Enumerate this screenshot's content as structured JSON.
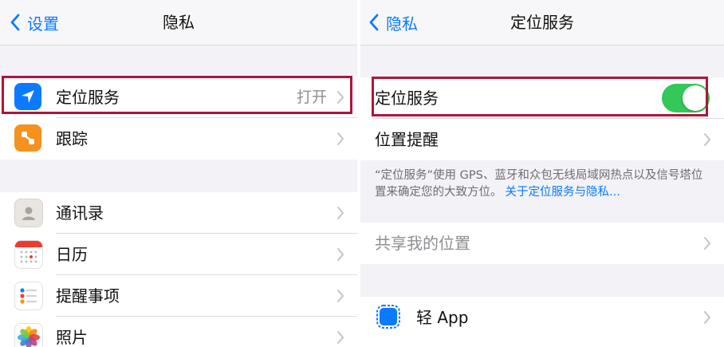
{
  "left": {
    "back_label": "设置",
    "title": "隐私",
    "group1": [
      {
        "label": "定位服务",
        "value": "打开",
        "icon": "location-arrow-icon",
        "color": "#0a7aff"
      },
      {
        "label": "跟踪",
        "icon": "tracking-icon",
        "color": "#f5911e"
      }
    ],
    "group2": [
      {
        "label": "通讯录",
        "icon": "contacts-icon"
      },
      {
        "label": "日历",
        "icon": "calendar-icon"
      },
      {
        "label": "提醒事项",
        "icon": "reminders-icon"
      },
      {
        "label": "照片",
        "icon": "photos-icon"
      }
    ]
  },
  "right": {
    "back_label": "隐私",
    "title": "定位服务",
    "location_toggle": {
      "label": "定位服务",
      "on": true,
      "color": "#34c759"
    },
    "location_alerts": {
      "label": "位置提醒"
    },
    "footnote_text": "“定位服务”使用 GPS、蓝牙和众包无线局域网热点以及信号塔位置来确定您的大致方位。",
    "footnote_link": "关于定位服务与隐私...",
    "share_location": {
      "label": "共享我的位置"
    },
    "apps": [
      {
        "label": "轻 App",
        "icon": "app-clip-icon"
      }
    ]
  },
  "colors": {
    "accent": "#0a7aff",
    "highlight": "#b0143a",
    "background": "#f2f2f7"
  }
}
